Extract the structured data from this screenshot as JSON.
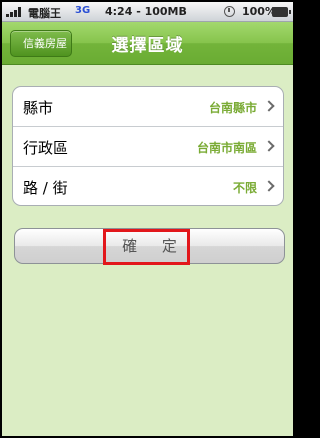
{
  "status_bar": {
    "carrier": "電腦王",
    "network": "3G",
    "time": "4:24 - 100MB",
    "battery": "100%"
  },
  "nav": {
    "back_label": "信義房屋",
    "title": "選擇區域"
  },
  "filters": [
    {
      "label": "縣市",
      "value": "台南縣市"
    },
    {
      "label": "行政區",
      "value": "台南市南區"
    },
    {
      "label": "路 / 街",
      "value": "不限"
    }
  ],
  "confirm_label": "確 定",
  "colors": {
    "nav_green": "#86c44c",
    "background": "#dbedc4",
    "value_green": "#7aab35",
    "highlight": "#e2171b"
  }
}
